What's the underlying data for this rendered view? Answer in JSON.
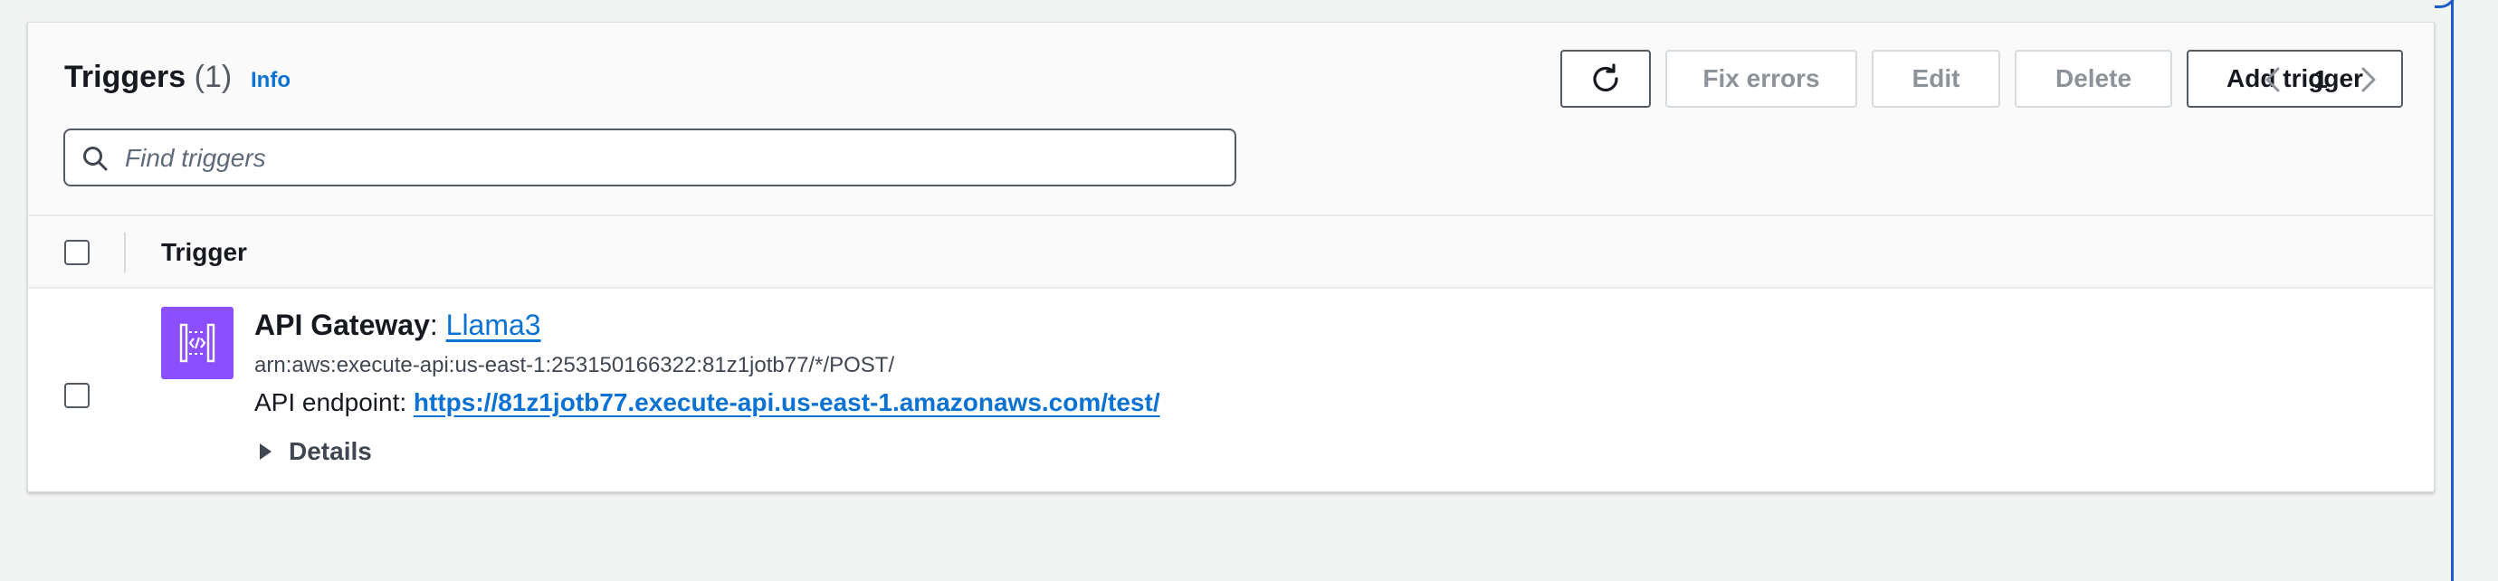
{
  "header": {
    "title": "Triggers",
    "count": "(1)",
    "info_link": "Info"
  },
  "toolbar": {
    "refresh_icon": "refresh-icon",
    "fix_errors_label": "Fix errors",
    "edit_label": "Edit",
    "delete_label": "Delete",
    "add_trigger_label": "Add trigger"
  },
  "search": {
    "placeholder": "Find triggers",
    "value": ""
  },
  "pagination": {
    "current_page": "1"
  },
  "table": {
    "columns": [
      "Trigger"
    ],
    "rows": [
      {
        "service": "API Gateway",
        "separator": ": ",
        "name": "Llama3",
        "icon": "api-gateway-icon",
        "arn": "arn:aws:execute-api:us-east-1:253150166322:81z1jotb77/*/POST/",
        "endpoint_label": "API endpoint: ",
        "endpoint_url": "https://81z1jotb77.execute-api.us-east-1.amazonaws.com/test/",
        "details_label": "Details"
      }
    ]
  },
  "colors": {
    "link": "#0972d3",
    "service_icon_bg": "#8c4fff",
    "disabled_text": "#8d9399",
    "page_bg": "#f2f3f3",
    "focus_edge": "#1c5cc8"
  }
}
